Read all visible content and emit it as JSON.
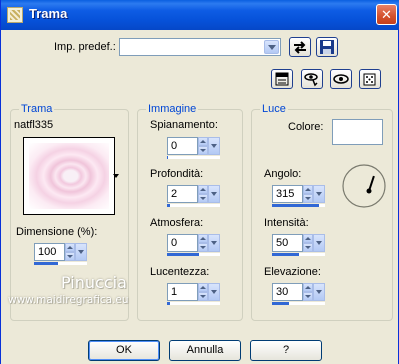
{
  "window": {
    "title": "Trama",
    "close_glyph": "✕"
  },
  "preset": {
    "label": "Imp. predef.:",
    "value": ""
  },
  "trama": {
    "title": "Trama",
    "texture_name": "natfl335",
    "dimension_label": "Dimensione (%):",
    "dimension_value": "100",
    "dimension_level": 0.45
  },
  "immagine": {
    "title": "Immagine",
    "fields": [
      {
        "label": "Spianamento:",
        "value": "0",
        "level": 0
      },
      {
        "label": "Profondità:",
        "value": "2",
        "level": 0.05
      },
      {
        "label": "Atmosfera:",
        "value": "0",
        "level": 0.6
      },
      {
        "label": "Lucentezza:",
        "value": "1",
        "level": 0.05
      }
    ]
  },
  "luce": {
    "title": "Luce",
    "color_label": "Colore:",
    "color_value": "#ffffff",
    "fields": [
      {
        "label": "Angolo:",
        "value": "315",
        "level": 0.88
      },
      {
        "label": "Intensità:",
        "value": "50",
        "level": 0.5
      },
      {
        "label": "Elevazione:",
        "value": "30",
        "level": 0.33
      }
    ],
    "angle_degrees": 315
  },
  "watermark": {
    "line1": "Pinuccia",
    "line2": "www.maidiregrafica.eu"
  },
  "buttons": {
    "ok": "OK",
    "cancel": "Annulla",
    "help": "?"
  },
  "icons": {
    "reset": "reset-icon",
    "save": "save-icon",
    "randomize": "randomize-icon",
    "view": "eye-icon",
    "proof": "proof-icon",
    "preview": "preview-icon"
  },
  "colors": {
    "accent": "#3168d5",
    "group_title": "#0046d5",
    "titlebar": "#0651d8"
  }
}
